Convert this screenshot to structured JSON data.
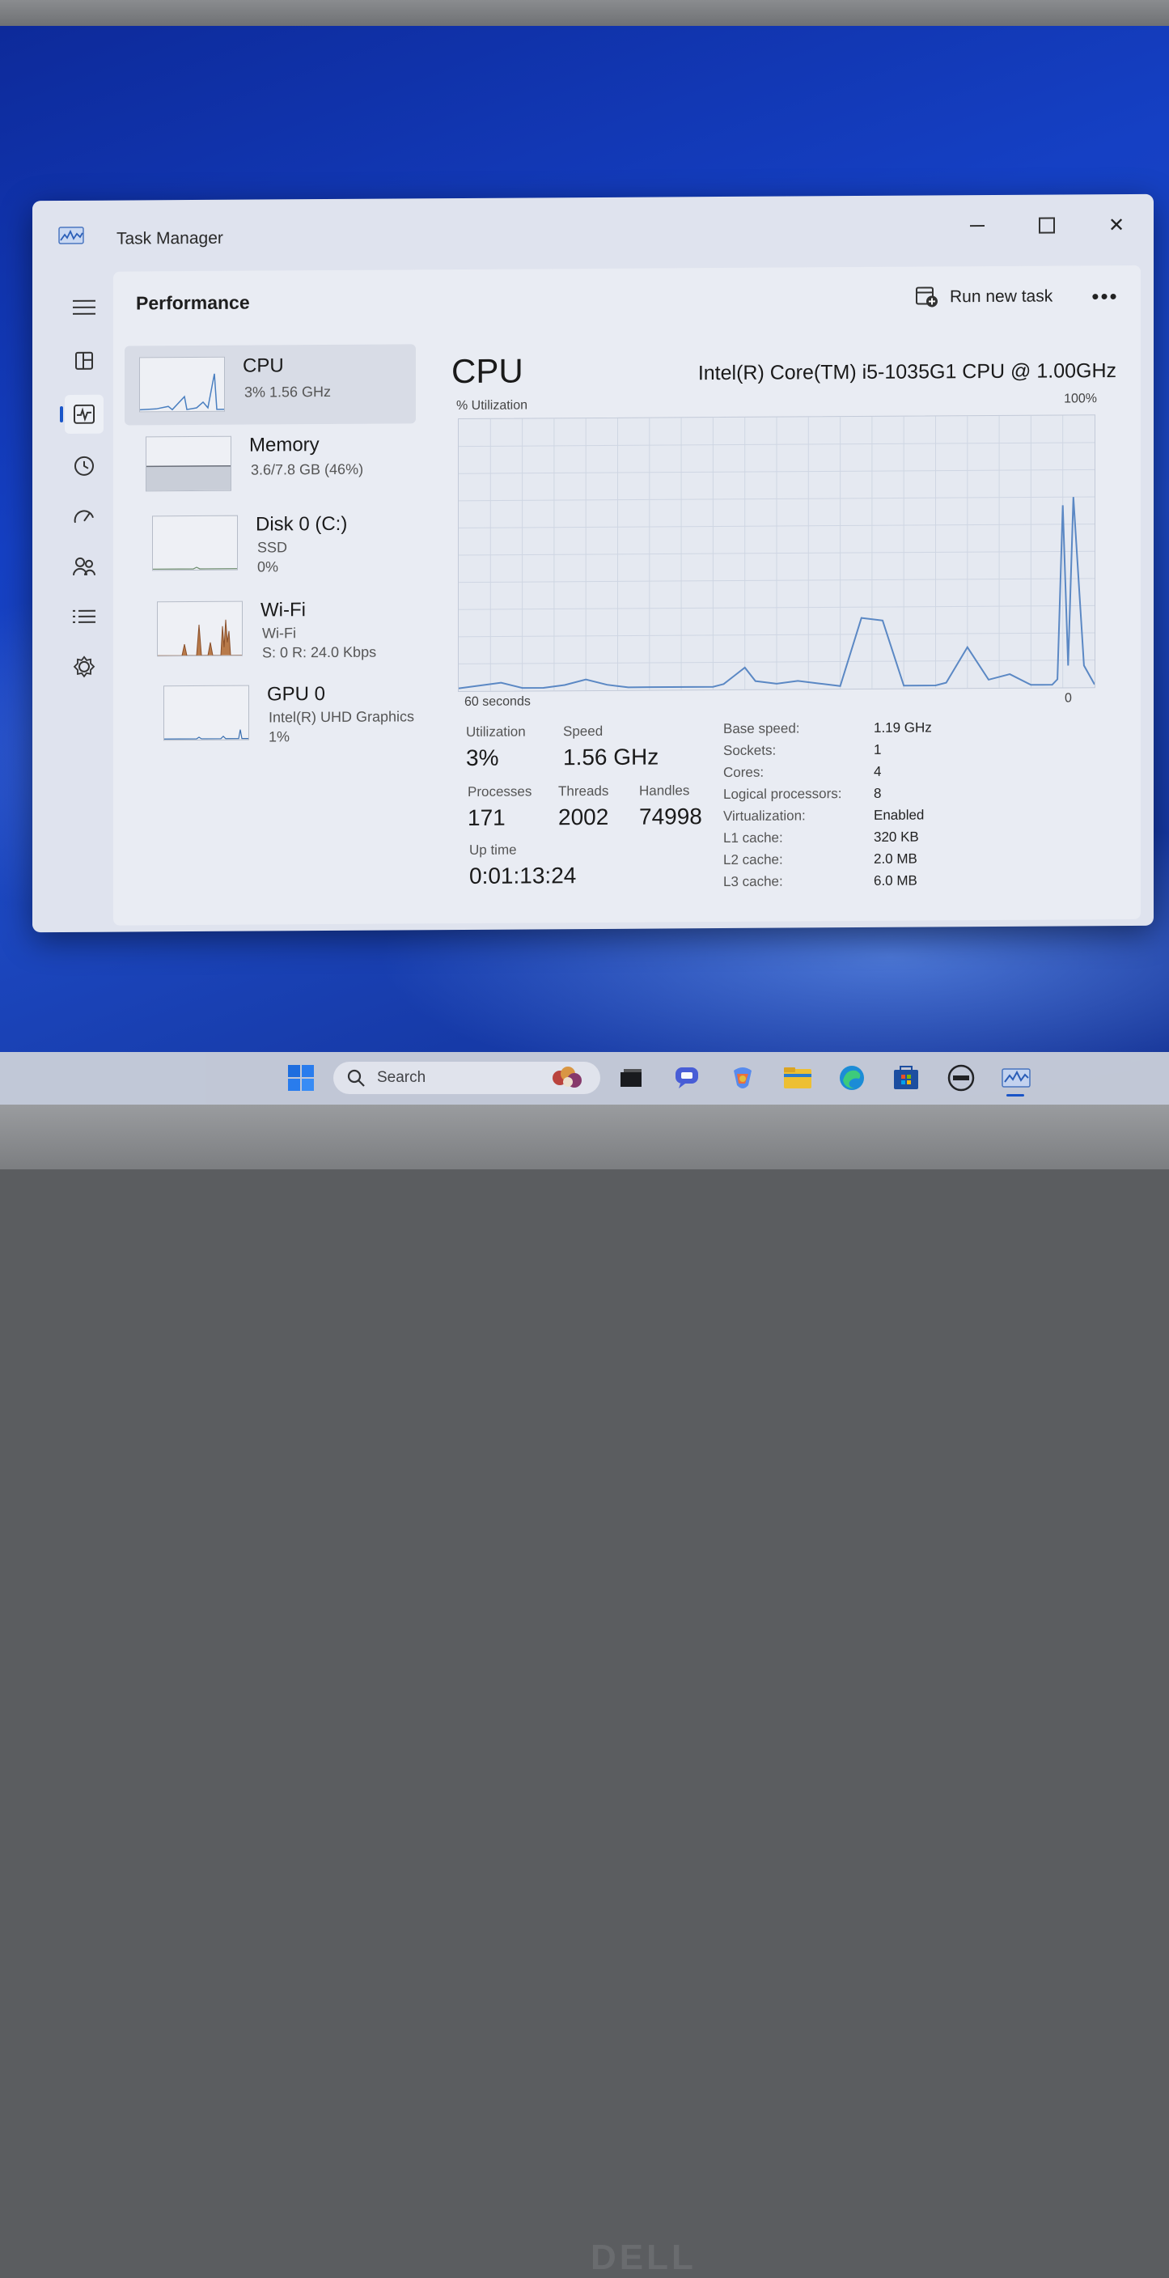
{
  "window": {
    "title": "Task Manager"
  },
  "content_header": {
    "title": "Performance",
    "run_new_task": "Run new task",
    "more": "•••"
  },
  "devices": [
    {
      "name": "CPU",
      "line1": "3%  1.56 GHz",
      "line2": "",
      "line3": ""
    },
    {
      "name": "Memory",
      "line1": "3.6/7.8 GB (46%)",
      "line2": "",
      "line3": ""
    },
    {
      "name": "Disk 0 (C:)",
      "line1": "SSD",
      "line2": "0%",
      "line3": ""
    },
    {
      "name": "Wi-Fi",
      "line1": "Wi-Fi",
      "line2": "S: 0 R: 24.0 Kbps",
      "line3": ""
    },
    {
      "name": "GPU 0",
      "line1": "Intel(R) UHD Graphics",
      "line2": "1%",
      "line3": ""
    }
  ],
  "detail": {
    "title": "CPU",
    "model": "Intel(R) Core(TM) i5-1035G1 CPU @ 1.00GHz",
    "y_label": "% Utilization",
    "y_max": "100%",
    "x_left": "60 seconds",
    "x_right": "0",
    "stats": {
      "utilization_label": "Utilization",
      "utilization": "3%",
      "speed_label": "Speed",
      "speed": "1.56 GHz",
      "processes_label": "Processes",
      "processes": "171",
      "threads_label": "Threads",
      "threads": "2002",
      "handles_label": "Handles",
      "handles": "74998",
      "uptime_label": "Up time",
      "uptime": "0:01:13:24"
    },
    "specs": [
      {
        "label": "Base speed:",
        "value": "1.19 GHz"
      },
      {
        "label": "Sockets:",
        "value": "1"
      },
      {
        "label": "Cores:",
        "value": "4"
      },
      {
        "label": "Logical processors:",
        "value": "8"
      },
      {
        "label": "Virtualization:",
        "value": "Enabled"
      },
      {
        "label": "L1 cache:",
        "value": "320 KB"
      },
      {
        "label": "L2 cache:",
        "value": "2.0 MB"
      },
      {
        "label": "L3 cache:",
        "value": "6.0 MB"
      }
    ]
  },
  "chart_data": {
    "type": "line",
    "title": "CPU",
    "ylabel": "% Utilization",
    "xlabel": "60 seconds",
    "ylim": [
      0,
      100
    ],
    "xlim": [
      60,
      0
    ],
    "x": [
      60,
      58,
      56,
      54,
      52,
      50,
      48,
      46,
      44,
      42,
      40,
      38,
      36,
      35,
      34,
      33,
      32,
      30,
      28,
      26,
      24,
      22,
      20,
      18,
      16,
      15,
      14,
      12,
      10,
      8,
      6,
      5,
      4,
      3.5,
      3,
      2.5,
      2,
      1,
      0
    ],
    "series": [
      {
        "values": [
          1,
          2,
          3,
          1,
          1,
          2,
          4,
          2,
          1,
          1,
          1,
          1,
          1,
          2,
          5,
          8,
          3,
          2,
          3,
          2,
          1,
          26,
          25,
          1,
          1,
          1,
          2,
          15,
          3,
          5,
          1,
          1,
          1,
          3,
          67,
          8,
          70,
          8,
          1
        ]
      }
    ],
    "grid": true,
    "line_color": "#5b88c4"
  },
  "taskbar": {
    "search_placeholder": "Search",
    "apps": [
      "start-icon",
      "widgets-icon",
      "task-view-icon",
      "chat-icon",
      "copilot-icon",
      "file-explorer-icon",
      "edge-icon",
      "store-icon",
      "dell-icon",
      "task-manager-icon"
    ]
  },
  "bezel": {
    "brand": "DELL"
  },
  "colors": {
    "accent": "#1a56c9",
    "window_bg": "#dfe3ee",
    "graph_line": "#5b88c4",
    "desktop": "#1540c4"
  }
}
